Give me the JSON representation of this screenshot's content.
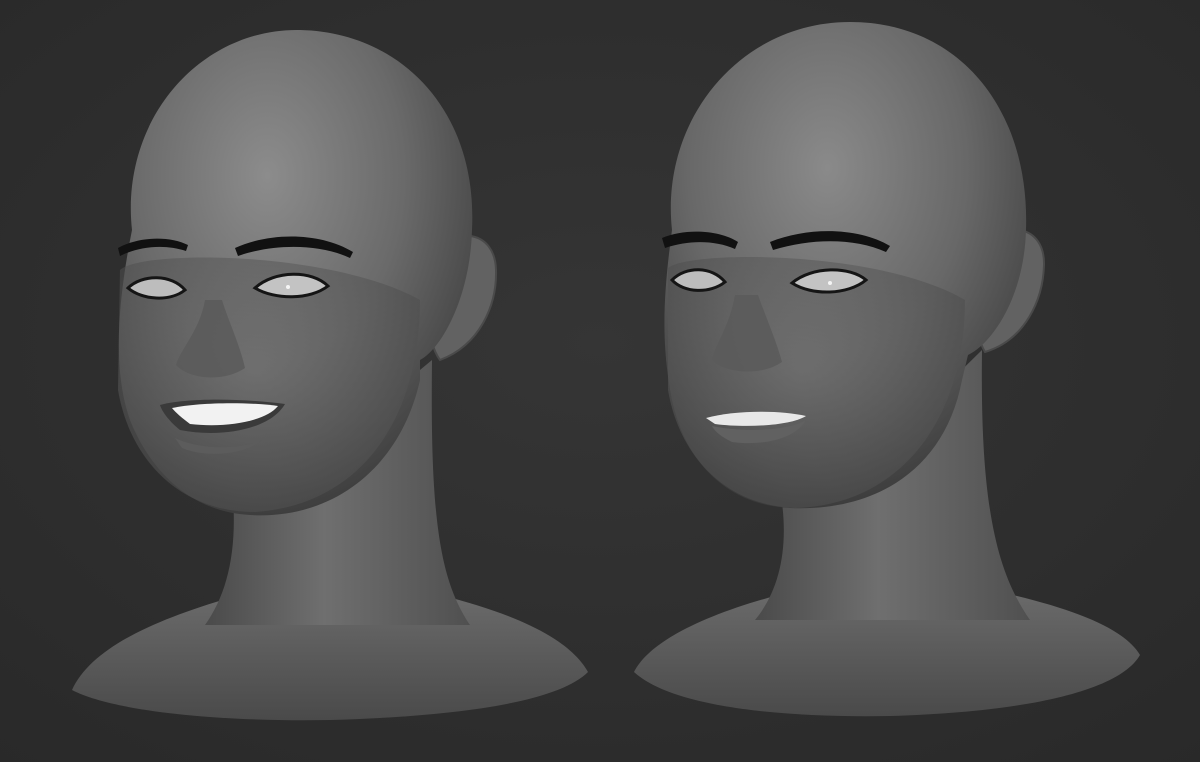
{
  "scene": {
    "background_color": "#2f2f2f",
    "material_color": "#6e6e6e",
    "teeth_color": "#f2f2f2",
    "brow_color": "#111111"
  },
  "models": [
    {
      "name": "head-sculpt-smiling",
      "expression": "smiling",
      "facing": "three-quarter-left"
    },
    {
      "name": "head-sculpt-neutral",
      "expression": "neutral",
      "facing": "three-quarter-left"
    }
  ]
}
